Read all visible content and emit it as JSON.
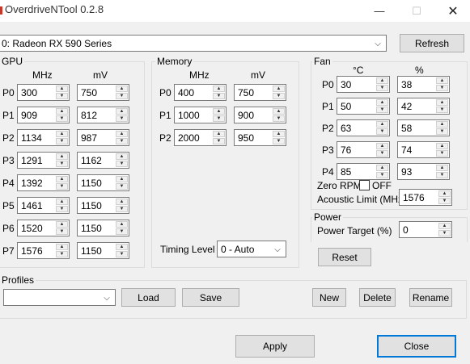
{
  "window": {
    "title": "OverdriveNTool 0.2.8",
    "minimize_glyph": "—",
    "maximize_glyph": "☐",
    "close_glyph": "✕"
  },
  "device": {
    "selected": "0: Radeon RX 590 Series"
  },
  "buttons": {
    "refresh": "Refresh",
    "reset": "Reset",
    "load": "Load",
    "save": "Save",
    "new": "New",
    "delete": "Delete",
    "rename": "Rename",
    "apply": "Apply",
    "close": "Close"
  },
  "gpu": {
    "label": "GPU",
    "col_mhz": "MHz",
    "col_mv": "mV",
    "rows": [
      {
        "p": "P0",
        "mhz": "300",
        "mv": "750"
      },
      {
        "p": "P1",
        "mhz": "909",
        "mv": "812"
      },
      {
        "p": "P2",
        "mhz": "1134",
        "mv": "987"
      },
      {
        "p": "P3",
        "mhz": "1291",
        "mv": "1162"
      },
      {
        "p": "P4",
        "mhz": "1392",
        "mv": "1150"
      },
      {
        "p": "P5",
        "mhz": "1461",
        "mv": "1150"
      },
      {
        "p": "P6",
        "mhz": "1520",
        "mv": "1150"
      },
      {
        "p": "P7",
        "mhz": "1576",
        "mv": "1150"
      }
    ]
  },
  "memory": {
    "label": "Memory",
    "col_mhz": "MHz",
    "col_mv": "mV",
    "rows": [
      {
        "p": "P0",
        "mhz": "400",
        "mv": "750"
      },
      {
        "p": "P1",
        "mhz": "1000",
        "mv": "900"
      },
      {
        "p": "P2",
        "mhz": "2000",
        "mv": "950"
      }
    ],
    "timing_label": "Timing Level",
    "timing_value": "0 - Auto"
  },
  "fan": {
    "label": "Fan",
    "col_temp": "°C",
    "col_pct": "%",
    "rows": [
      {
        "p": "P0",
        "temp": "30",
        "pct": "38"
      },
      {
        "p": "P1",
        "temp": "50",
        "pct": "42"
      },
      {
        "p": "P2",
        "temp": "63",
        "pct": "58"
      },
      {
        "p": "P3",
        "temp": "76",
        "pct": "74"
      },
      {
        "p": "P4",
        "temp": "85",
        "pct": "93"
      }
    ],
    "zero_rpm_label": "Zero RPM",
    "zero_rpm_state": "OFF",
    "acoustic_label": "Acoustic Limit (MHz)",
    "acoustic_value": "1576"
  },
  "power": {
    "label": "Power",
    "target_label": "Power Target (%)",
    "target_value": "0"
  },
  "profiles": {
    "label": "Profiles",
    "selected": ""
  }
}
